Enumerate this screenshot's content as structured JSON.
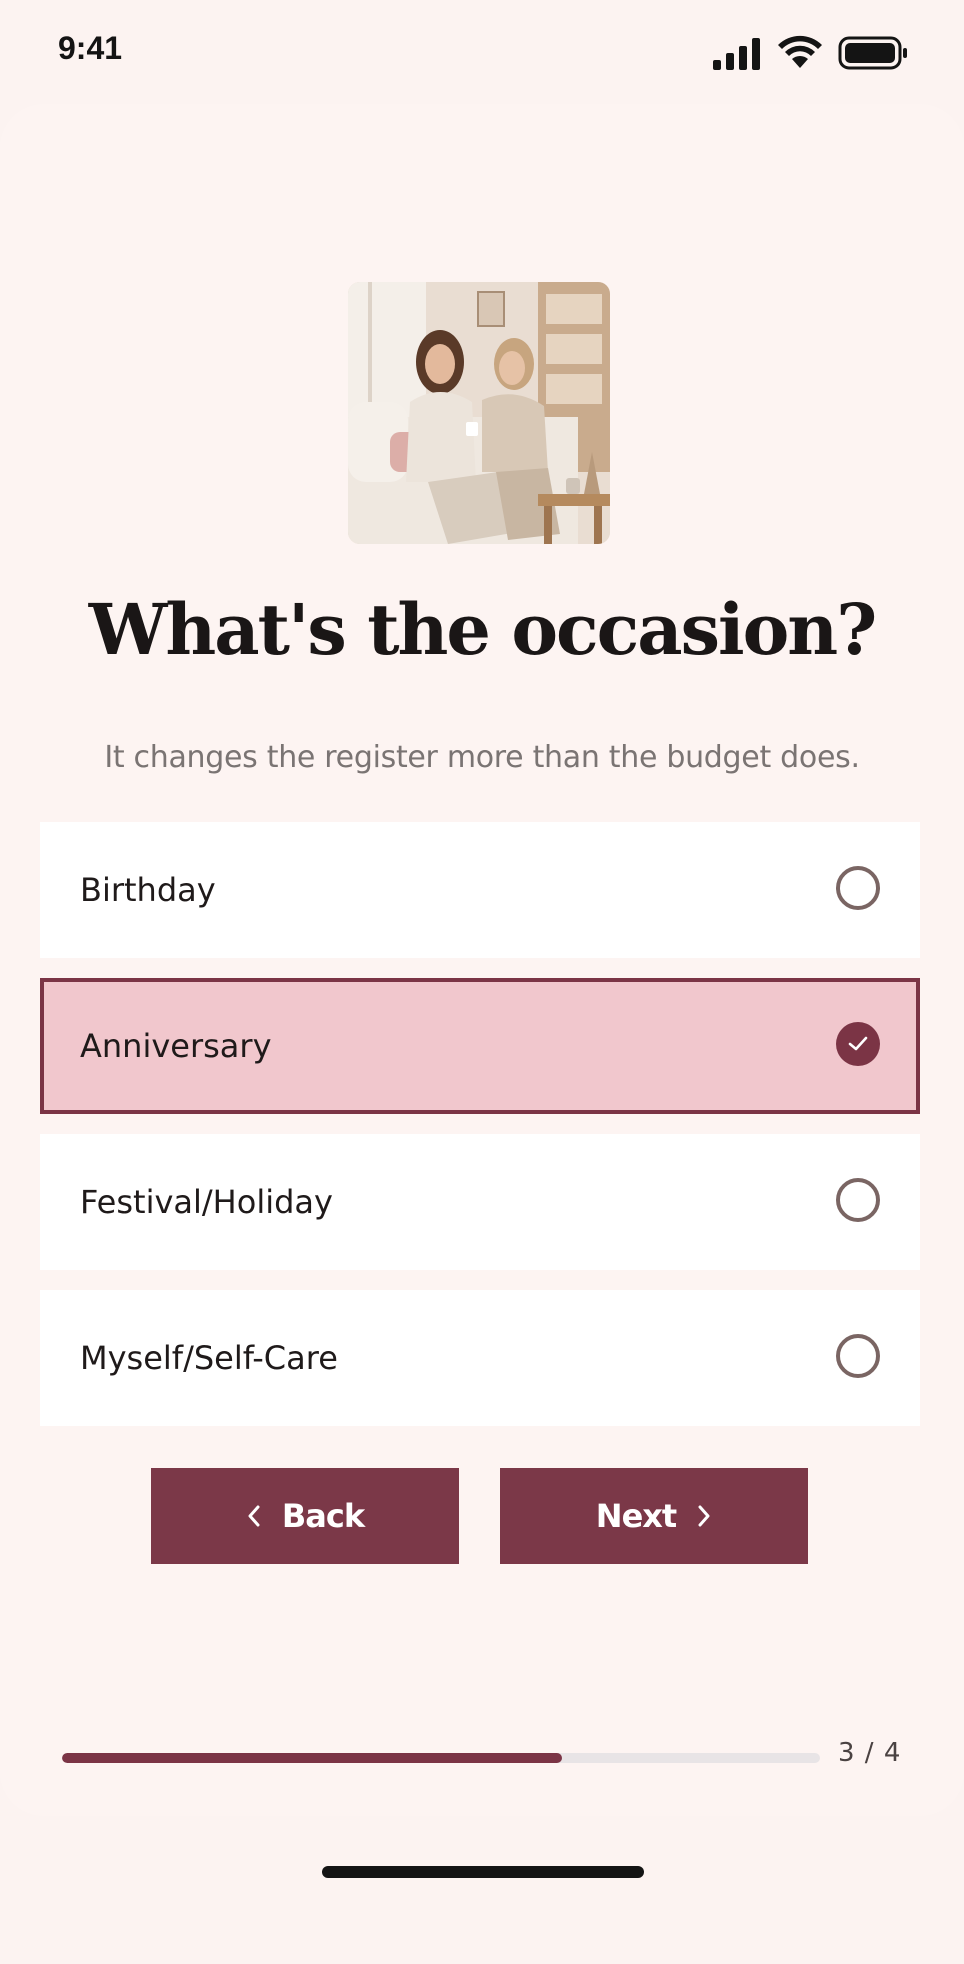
{
  "status_bar": {
    "time": "9:41",
    "icons": [
      "signal-icon",
      "wifi-icon",
      "battery-icon"
    ]
  },
  "title": "What's the occasion?",
  "subtitle": "It changes the register more than the budget does.",
  "options": [
    {
      "label": "Birthday",
      "selected": false
    },
    {
      "label": "Anniversary",
      "selected": true
    },
    {
      "label": "Festival/Holiday",
      "selected": false
    },
    {
      "label": "Myself/Self-Care",
      "selected": false
    }
  ],
  "buttons": {
    "back_label": "Back",
    "next_label": "Next"
  },
  "progress": {
    "label": "3 / 4",
    "fraction": 0.66
  },
  "colors": {
    "accent": "#7b3445",
    "selected_bg": "#f1c7cd",
    "background": "#fcf3f1"
  }
}
